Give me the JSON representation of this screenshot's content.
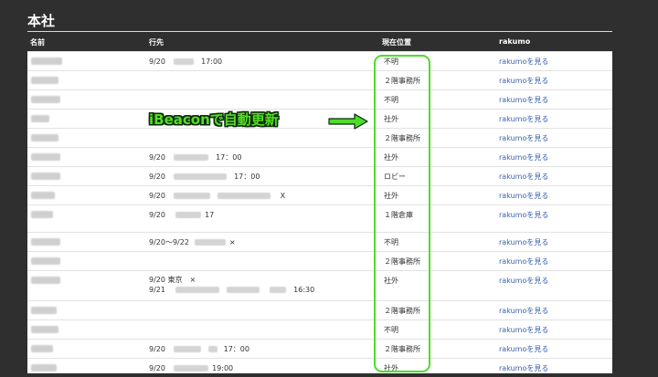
{
  "page": {
    "title": "本社"
  },
  "columns": {
    "name": "名前",
    "destination": "行先",
    "location": "現在位置",
    "rakumo": "rakumo"
  },
  "callout": "iBeaconで自動更新",
  "rows": [
    {
      "dest": "9/20",
      "dest2": "17:00",
      "loc": "不明",
      "link": "rakumoを見る"
    },
    {
      "dest": "",
      "dest2": "",
      "loc": "２階事務所",
      "link": "rakumoを見る"
    },
    {
      "dest": "",
      "dest2": "",
      "loc": "不明",
      "link": "rakumoを見る"
    },
    {
      "dest": "",
      "dest2": "",
      "loc": "社外",
      "link": "rakumoを見る"
    },
    {
      "dest": "",
      "dest2": "",
      "loc": "２階事務所",
      "link": "rakumoを見る"
    },
    {
      "dest": "9/20",
      "dest2": "17：00",
      "loc": "社外",
      "link": "rakumoを見る"
    },
    {
      "dest": "9/20",
      "dest2": "17：00",
      "loc": "ロビー",
      "link": "rakumoを見る"
    },
    {
      "dest": "9/20",
      "dest2": "X",
      "loc": "社外",
      "link": "rakumoを見る"
    },
    {
      "dest": "9/20",
      "dest2": "17",
      "loc": "１階倉庫",
      "link": "rakumoを見る"
    },
    {
      "dest": "9/20〜9/22",
      "dest2": "×",
      "loc": "不明",
      "link": "rakumoを見る"
    },
    {
      "dest": "",
      "dest2": "",
      "loc": "２階事務所",
      "link": "rakumoを見る"
    },
    {
      "dest": "9/20 東京　×",
      "dest2": "9/21",
      "dest3": "16:30",
      "loc": "社外",
      "link": "rakumoを見る"
    },
    {
      "dest": "",
      "dest2": "",
      "loc": "２階事務所",
      "link": "rakumoを見る"
    },
    {
      "dest": "",
      "dest2": "",
      "loc": "不明",
      "link": "rakumoを見る"
    },
    {
      "dest": "9/20",
      "dest2": "17：00",
      "loc": "２階事務所",
      "link": "rakumoを見る"
    },
    {
      "dest": "9/20",
      "dest2": "19:00",
      "loc": "社外",
      "link": "rakumoを見る"
    }
  ],
  "colors": {
    "highlight": "#4cdd2a",
    "link": "#3a63b0",
    "background": "#2f2f2f"
  }
}
